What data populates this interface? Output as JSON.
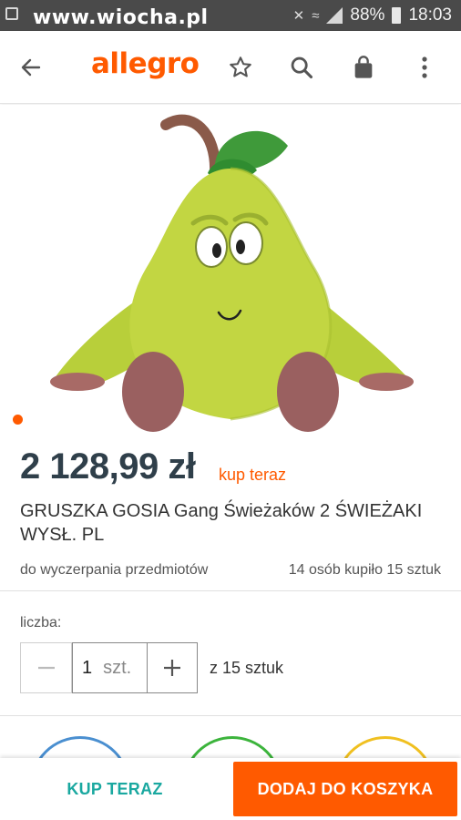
{
  "status_bar": {
    "watermark": "www.wiocha.pl",
    "battery": "88%",
    "time": "18:03"
  },
  "app_bar": {
    "logo": "allegro",
    "icons": [
      "back-arrow-icon",
      "star-icon",
      "search-icon",
      "shopping-bag-icon",
      "more-vert-icon"
    ]
  },
  "product": {
    "price": "2 128,99 zł",
    "buy_now_tag": "kup teraz",
    "title": "GRUSZKA GOSIA Gang Świeżaków 2 ŚWIEŻAKI WYSŁ. PL",
    "availability": "do wyczerpania przedmiotów",
    "sold": "14 osób kupiło 15 sztuk",
    "carousel_total": 1,
    "carousel_current": 1
  },
  "quantity": {
    "label": "liczba:",
    "value": "1",
    "unit": "szt.",
    "available": "z 15 sztuk"
  },
  "actions": {
    "buy_now": "KUP TERAZ",
    "add_to_cart": "DODAJ DO KOSZYKA"
  },
  "colors": {
    "brand": "#ff5a00",
    "buy_now_text": "#1aa8a0",
    "price": "#2f3f4a"
  }
}
